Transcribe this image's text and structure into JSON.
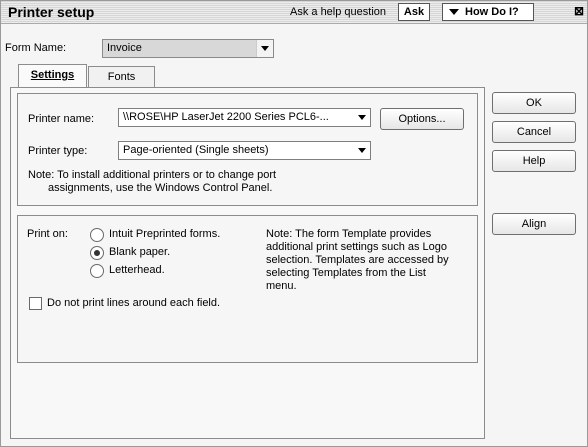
{
  "titlebar": {
    "title": "Printer setup",
    "help_question": "Ask a help question",
    "ask_label": "Ask",
    "how_do_i_label": "How Do I?",
    "close_glyph": "⊠"
  },
  "form_name": {
    "label": "Form Name:",
    "value": "Invoice"
  },
  "tabs": [
    {
      "label": "Settings",
      "active": true
    },
    {
      "label": "Fonts",
      "active": false
    }
  ],
  "printer": {
    "name_label": "Printer name:",
    "name_value": "\\\\ROSE\\HP LaserJet 2200 Series PCL6-...",
    "options_label": "Options...",
    "type_label": "Printer type:",
    "type_value": "Page-oriented (Single sheets)",
    "note_line1": "Note: To install additional printers or to change port",
    "note_line2": "assignments, use the Windows Control Panel."
  },
  "print_on": {
    "label": "Print on:",
    "options": [
      {
        "label": "Intuit Preprinted forms.",
        "selected": false
      },
      {
        "label": "Blank paper.",
        "selected": true
      },
      {
        "label": "Letterhead.",
        "selected": false
      }
    ],
    "note": [
      "Note: The form Template provides",
      "additional print settings such as Logo",
      "selection.  Templates are accessed by",
      "selecting Templates from the List",
      "menu."
    ],
    "checkbox_label": "Do not print lines around each field.",
    "checkbox_checked": false
  },
  "buttons": {
    "ok": "OK",
    "cancel": "Cancel",
    "help": "Help",
    "align": "Align"
  }
}
